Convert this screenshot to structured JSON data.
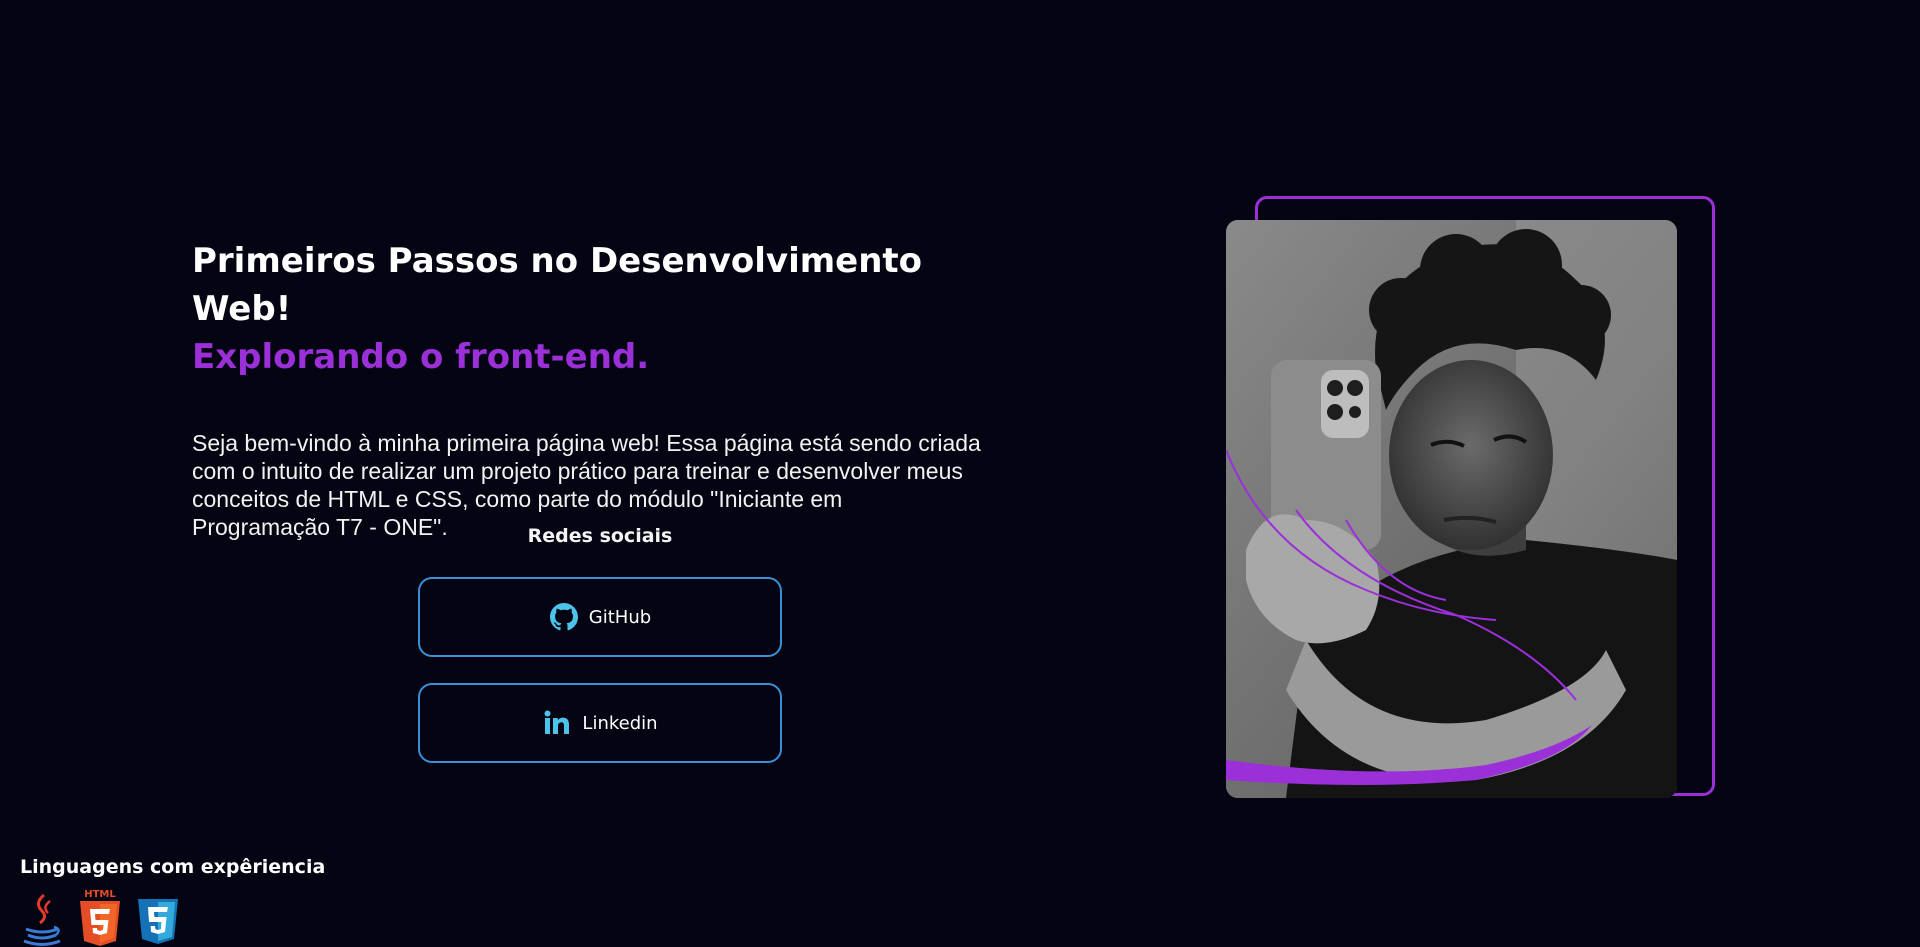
{
  "hero": {
    "title": "Primeiros Passos no Desenvolvimento Web!",
    "subtitle": "Explorando o front-end.",
    "description": "Seja bem-vindo à minha primeira página web! Essa página está sendo criada com o intuito de realizar um projeto prático para treinar e desenvolver meus conceitos de HTML e CSS, como parte do módulo \"Iniciante em Programação T7 - ONE\"."
  },
  "social": {
    "heading": "Redes sociais",
    "links": [
      {
        "label": "GitHub",
        "icon": "github-icon"
      },
      {
        "label": "Linkedin",
        "icon": "linkedin-icon"
      }
    ]
  },
  "languages": {
    "heading": "Linguagens com expêriencia",
    "items": [
      {
        "name": "java",
        "icon": "java-icon"
      },
      {
        "name": "html5",
        "icon": "html5-icon",
        "badge": "HTML"
      },
      {
        "name": "css3",
        "icon": "css3-icon"
      }
    ]
  },
  "colors": {
    "background": "#040412",
    "accent": "#9b30d9",
    "button_border": "#3a8fd6",
    "icon_blue": "#4cc3e8"
  }
}
